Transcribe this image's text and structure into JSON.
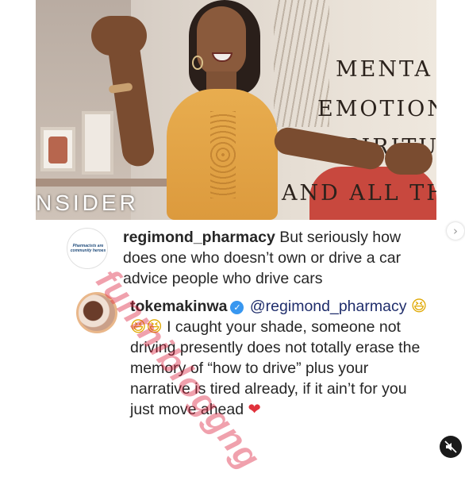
{
  "photo": {
    "wall_text": {
      "line1": "MENTA",
      "line2": "EMOTION",
      "line3": "SPIRITUA",
      "line4": "AND ALL TH"
    },
    "overlay_text": "NSIDER"
  },
  "watermark": "funmibloggng",
  "comments": [
    {
      "avatar_text": "Pharmacists are community heroes",
      "username": "regimond_pharmacy",
      "text": " But seriously how does one who doesn’t own or drive a car advice people who drive cars"
    },
    {
      "username": "tokemakinwa",
      "verified_icon": "✓",
      "mention": "@regimond_pharmacy",
      "emojis": "😆😆😆",
      "text": " I caught your shade, someone not driving presently does not totally erase the memory of “how to drive” plus your narrative is tired already, if it ain’t for you just move ahead ",
      "end_emoji": "❤"
    }
  ],
  "controls": {
    "next_icon": "›",
    "mute_icon": "speaker-muted-icon"
  }
}
